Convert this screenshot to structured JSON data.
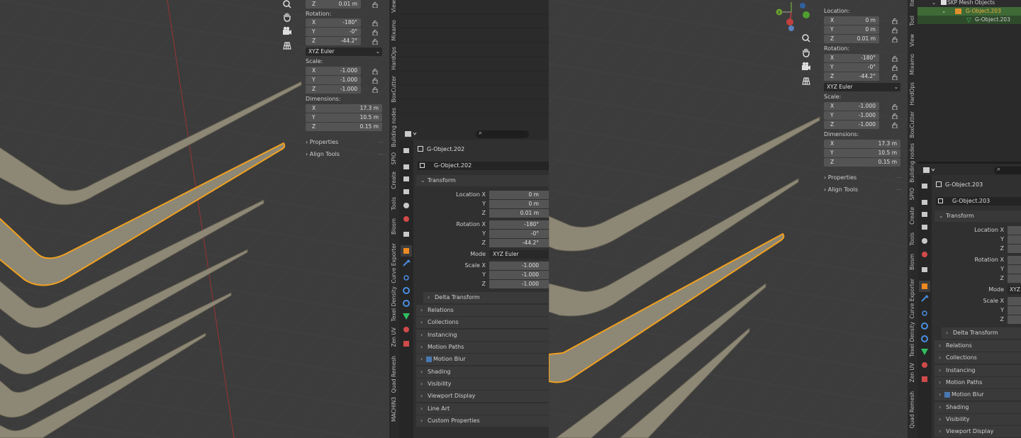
{
  "left_npanel": {
    "loc_z": {
      "axis": "Z",
      "value": "0.01 m"
    },
    "rotation_label": "Rotation:",
    "rot": [
      {
        "axis": "X",
        "value": "-180°"
      },
      {
        "axis": "Y",
        "value": "-0°"
      },
      {
        "axis": "Z",
        "value": "-44.2°"
      }
    ],
    "mode": "XYZ Euler",
    "scale_label": "Scale:",
    "scale": [
      {
        "axis": "X",
        "value": "-1.000"
      },
      {
        "axis": "Y",
        "value": "-1.000"
      },
      {
        "axis": "Z",
        "value": "-1.000"
      }
    ],
    "dimensions_label": "Dimensions:",
    "dims": [
      {
        "axis": "X",
        "value": "17.3 m"
      },
      {
        "axis": "Y",
        "value": "10.5 m"
      },
      {
        "axis": "Z",
        "value": "0.15 m"
      }
    ],
    "properties": "Properties",
    "align_tools": "Align Tools"
  },
  "left_tabs": [
    "View",
    "Mixamo",
    "HardOps",
    "BoxCutter",
    "Building nodes",
    "SPIO",
    "Create",
    "Tools",
    "Blosm",
    "Curve Exporter",
    "Texel Density",
    "Zen UV",
    "Quad Remesh",
    "MACHIN3"
  ],
  "mid_props": {
    "object_name": "G-Object.202",
    "datablock": "G-Object.202",
    "transform": "Transform",
    "location_x": "Location X",
    "loc": [
      "0 m",
      "0 m",
      "0.01 m"
    ],
    "rotation_x": "Rotation X",
    "rot": [
      "-180°",
      "-0°",
      "-44.2°"
    ],
    "mode_label": "Mode",
    "mode": "XYZ Euler",
    "scale_x": "Scale X",
    "scale": [
      "-1.000",
      "-1.000",
      "-1.000"
    ],
    "y": "Y",
    "z": "Z",
    "delta": "Delta Transform",
    "panels": [
      "Relations",
      "Collections",
      "Instancing",
      "Motion Paths",
      "Motion Blur",
      "Shading",
      "Visibility",
      "Viewport Display",
      "Line Art",
      "Custom Properties"
    ]
  },
  "right_npanel": {
    "location_label": "Location:",
    "loc": [
      {
        "axis": "X",
        "value": "0 m"
      },
      {
        "axis": "Y",
        "value": "0 m"
      },
      {
        "axis": "Z",
        "value": "0.01 m"
      }
    ],
    "rotation_label": "Rotation:",
    "rot": [
      {
        "axis": "X",
        "value": "-180°"
      },
      {
        "axis": "Y",
        "value": "-0°"
      },
      {
        "axis": "Z",
        "value": "-44.2°"
      }
    ],
    "mode": "XYZ Euler",
    "scale_label": "Scale:",
    "scale": [
      {
        "axis": "X",
        "value": "-1.000"
      },
      {
        "axis": "Y",
        "value": "-1.000"
      },
      {
        "axis": "Z",
        "value": "-1.000"
      }
    ],
    "dimensions_label": "Dimensions:",
    "dims": [
      {
        "axis": "X",
        "value": "17.3 m"
      },
      {
        "axis": "Y",
        "value": "10.5 m"
      },
      {
        "axis": "Z",
        "value": "0.15 m"
      }
    ],
    "properties": "Properties",
    "align_tools": "Align Tools"
  },
  "right_tabs": [
    "Item",
    "Tool",
    "View",
    "Mixamo",
    "HardOps",
    "BoxCutter",
    "Building nodes",
    "SPIO",
    "Create",
    "Tools",
    "Blosm",
    "Curve Exporter",
    "Texel Density",
    "Zen UV",
    "Quad Remesh"
  ],
  "outliner": {
    "collection": "SKP Mesh Objects",
    "object": "G-Object.203",
    "mesh": "G-Object.203"
  },
  "right_props": {
    "object_name": "G-Object.203",
    "datablock": "G-Object.203",
    "transform": "Transform",
    "location_x": "Location X",
    "rotation_x": "Rotation X",
    "mode_label": "Mode",
    "mode": "XYZ",
    "scale_x": "Scale X",
    "y": "Y",
    "z": "Z",
    "delta": "Delta Transform",
    "panels": [
      "Relations",
      "Collections",
      "Instancing",
      "Motion Paths",
      "Motion Blur",
      "Shading",
      "Visibility",
      "Viewport Display"
    ]
  },
  "colors": {
    "viewport": "#3d3d3d",
    "grid": "#4a4a4a",
    "shape": "#8f8a78",
    "selected": "#f0a020",
    "axis_red": "#a33a3a"
  }
}
